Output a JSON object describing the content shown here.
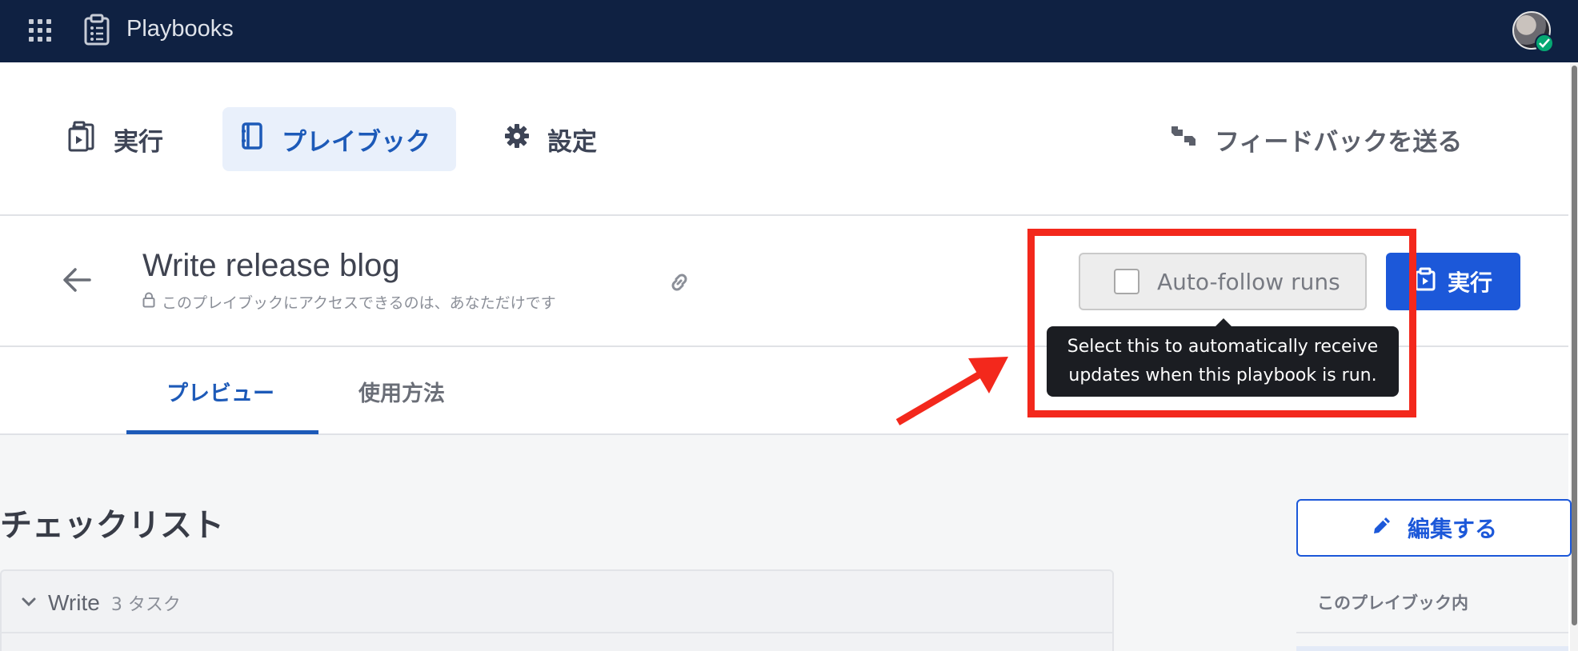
{
  "app": {
    "title": "Playbooks"
  },
  "nav": {
    "runs": "実行",
    "playbooks": "プレイブック",
    "settings": "設定",
    "feedback": "フィードバックを送る"
  },
  "playbook": {
    "title": "Write release blog",
    "access_note": "このプレイブックにアクセスできるのは、あなただけです",
    "auto_follow_label": "Auto-follow runs",
    "auto_follow_checked": false,
    "run_label": "実行",
    "tooltip_line1": "Select this to automatically receive",
    "tooltip_line2": "updates when this playbook is run."
  },
  "tabs": {
    "preview": "プレビュー",
    "usage": "使用方法"
  },
  "content": {
    "checklist_heading": "チェックリスト",
    "checklist_title": "Write",
    "checklist_count": "3 タスク",
    "edit_label": "編集する",
    "in_playbook_label": "このプレイブック内"
  },
  "colors": {
    "header_bg": "#0f2142",
    "accent": "#1c58d9",
    "annotation": "#f3281c",
    "online_status": "#06a873"
  },
  "icons": [
    "grid-icon",
    "playbook-app-icon",
    "runs-icon",
    "playbook-icon",
    "gear-icon",
    "feedback-icon",
    "back-arrow-icon",
    "lock-icon",
    "link-icon",
    "run-icon",
    "chevron-down-icon",
    "pencil-icon",
    "check-icon"
  ]
}
